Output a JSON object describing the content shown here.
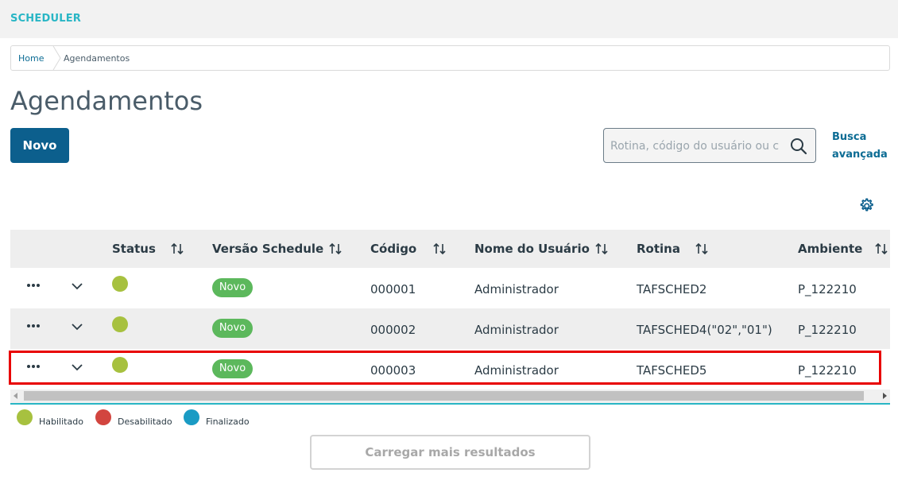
{
  "app": {
    "title": "SCHEDULER"
  },
  "breadcrumb": {
    "home": "Home",
    "current": "Agendamentos"
  },
  "page": {
    "title": "Agendamentos"
  },
  "toolbar": {
    "new_label": "Novo",
    "search_placeholder": "Rotina, código do usuário ou c",
    "advanced_search_label": "Busca avançada"
  },
  "table": {
    "columns": [
      "Status",
      "Versão Schedule",
      "Código",
      "Nome do Usuário",
      "Rotina",
      "Ambiente"
    ],
    "rows": [
      {
        "status": "Habilitado",
        "version": "Novo",
        "code": "000001",
        "user": "Administrador",
        "routine": "TAFSCHED2",
        "environment": "P_122210"
      },
      {
        "status": "Habilitado",
        "version": "Novo",
        "code": "000002",
        "user": "Administrador",
        "routine": "TAFSCHED4(\"02\",\"01\")",
        "environment": "P_122210"
      },
      {
        "status": "Habilitado",
        "version": "Novo",
        "code": "000003",
        "user": "Administrador",
        "routine": "TAFSCHED5",
        "environment": "P_122210"
      }
    ]
  },
  "legend": {
    "items": [
      {
        "label": "Habilitado",
        "color": "#a7c13f"
      },
      {
        "label": "Desabilitado",
        "color": "#d2453f"
      },
      {
        "label": "Finalizado",
        "color": "#1a9bc4"
      }
    ]
  },
  "footer": {
    "load_more_label": "Carregar mais resultados"
  },
  "colors": {
    "accent": "#0c5f8d",
    "brand": "#29b6c5",
    "badge": "#5cb85c",
    "highlight": "#e80000"
  }
}
